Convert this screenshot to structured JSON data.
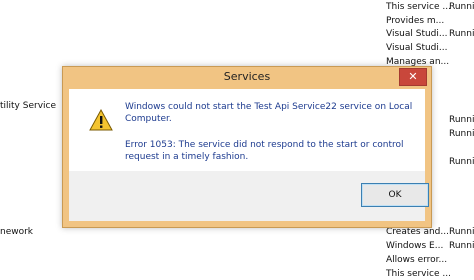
{
  "background_services": {
    "description_column": [
      "This service ...",
      "Provides m...",
      "Visual Studi...",
      "Visual Studi...",
      "Manages an...",
      "Creates and...",
      "Windows E...",
      "Allows error...",
      "This service ..."
    ],
    "status_column": [
      "Runni",
      "Runni",
      "Runni",
      "Runni",
      "Runni",
      "Runni",
      "Runni"
    ],
    "name_fragments": [
      "tility Service",
      "nework"
    ]
  },
  "dialog": {
    "title": "Services",
    "close_glyph": "✕",
    "message_line1": "Windows could not start the Test Api Service22 service on Local Computer.",
    "message_line2": "Error 1053: The service did not respond to the start or control request in a timely fashion.",
    "ok_label": "OK",
    "icon": "warning-icon"
  },
  "colors": {
    "dialog_frame": "#f1c483",
    "close_button": "#c9473b",
    "message_text": "#1d3b8f"
  }
}
